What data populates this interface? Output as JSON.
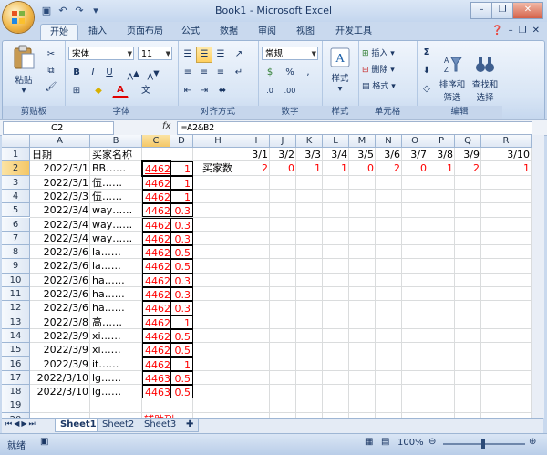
{
  "window": {
    "title": "Book1 - Microsoft Excel"
  },
  "tabs": [
    "开始",
    "插入",
    "页面布局",
    "公式",
    "数据",
    "审阅",
    "视图",
    "开发工具"
  ],
  "ribbon": {
    "clipboard": {
      "label": "剪贴板",
      "paste": "粘贴"
    },
    "font": {
      "label": "字体",
      "name": "宋体",
      "size": "11",
      "bold": "B",
      "italic": "I",
      "underline": "U"
    },
    "alignment": {
      "label": "对齐方式"
    },
    "number": {
      "label": "数字",
      "format": "常规"
    },
    "styles": {
      "label": "样式"
    },
    "cells": {
      "label": "单元格",
      "insert": "插入",
      "delete": "删除",
      "format": "格式"
    },
    "editing": {
      "label": "编辑",
      "sort": "排序和\n筛选",
      "find": "查找和\n选择"
    }
  },
  "formula_bar": {
    "name_box": "C2",
    "fx": "fx",
    "formula": "=A2&B2"
  },
  "columns": [
    "A",
    "B",
    "C",
    "D",
    "H",
    "I",
    "J",
    "K",
    "L",
    "M",
    "N",
    "O",
    "P",
    "Q",
    "R"
  ],
  "rows": [
    "1",
    "2",
    "3",
    "4",
    "5",
    "6",
    "7",
    "8",
    "9",
    "10",
    "11",
    "12",
    "13",
    "14",
    "15",
    "16",
    "17",
    "18",
    "19",
    "20",
    "21"
  ],
  "header_row": {
    "a": "日期",
    "b": "买家名称"
  },
  "data_rows": [
    {
      "a": "2022/3/1",
      "b": "BB……",
      "c": "4462",
      "d": "1"
    },
    {
      "a": "2022/3/1",
      "b": "伍……",
      "c": "4462",
      "d": "1"
    },
    {
      "a": "2022/3/3",
      "b": "伍……",
      "c": "4462",
      "d": "1"
    },
    {
      "a": "2022/3/4",
      "b": "way……",
      "c": "4462",
      "d": "0.3"
    },
    {
      "a": "2022/3/4",
      "b": "way……",
      "c": "4462",
      "d": "0.3"
    },
    {
      "a": "2022/3/4",
      "b": "way……",
      "c": "4462",
      "d": "0.3"
    },
    {
      "a": "2022/3/6",
      "b": "la……",
      "c": "4462",
      "d": "0.5"
    },
    {
      "a": "2022/3/6",
      "b": "la……",
      "c": "4462",
      "d": "0.5"
    },
    {
      "a": "2022/3/6",
      "b": "ha……",
      "c": "4462",
      "d": "0.3"
    },
    {
      "a": "2022/3/6",
      "b": "ha……",
      "c": "4462",
      "d": "0.3"
    },
    {
      "a": "2022/3/6",
      "b": "ha……",
      "c": "4462",
      "d": "0.3"
    },
    {
      "a": "2022/3/8",
      "b": "高……",
      "c": "4462",
      "d": "1"
    },
    {
      "a": "2022/3/9",
      "b": "xi……",
      "c": "4462",
      "d": "0.5"
    },
    {
      "a": "2022/3/9",
      "b": "xi……",
      "c": "4462",
      "d": "0.5"
    },
    {
      "a": "2022/3/9",
      "b": "it……",
      "c": "4462",
      "d": "1"
    },
    {
      "a": "2022/3/10",
      "b": "lg……",
      "c": "4463",
      "d": "0.5"
    },
    {
      "a": "2022/3/10",
      "b": "lg……",
      "c": "4463",
      "d": "0.5"
    }
  ],
  "helper_label": "辅助列",
  "summary": {
    "label": "买家数",
    "dates": [
      "3/1",
      "3/2",
      "3/3",
      "3/4",
      "3/5",
      "3/6",
      "3/7",
      "3/8",
      "3/9",
      "3/10"
    ],
    "counts": [
      "2",
      "0",
      "1",
      "1",
      "0",
      "2",
      "0",
      "1",
      "2",
      "1"
    ]
  },
  "sheets": [
    "Sheet1",
    "Sheet2",
    "Sheet3"
  ],
  "status": {
    "ready": "就绪",
    "zoom": "100%"
  },
  "colors": {
    "accent_red": "#ff0000",
    "grid": "#dadcdd",
    "header": "#dfe8f4"
  }
}
